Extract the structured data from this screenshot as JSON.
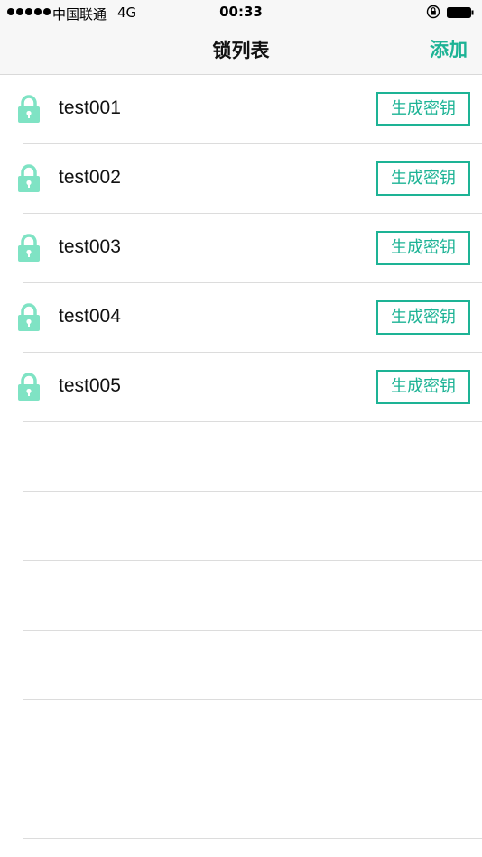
{
  "status_bar": {
    "carrier": "中国联通",
    "network": "4G",
    "time": "00:33"
  },
  "nav": {
    "title": "锁列表",
    "add_label": "添加"
  },
  "colors": {
    "accent": "#1db395",
    "lock_icon": "#7fe3c4"
  },
  "icons": {
    "lock": "lock-icon",
    "orientation": "orientation-lock-icon",
    "battery": "battery-icon"
  },
  "locks": [
    {
      "name": "test001",
      "button_label": "生成密钥"
    },
    {
      "name": "test002",
      "button_label": "生成密钥"
    },
    {
      "name": "test003",
      "button_label": "生成密钥"
    },
    {
      "name": "test004",
      "button_label": "生成密钥"
    },
    {
      "name": "test005",
      "button_label": "生成密钥"
    }
  ]
}
